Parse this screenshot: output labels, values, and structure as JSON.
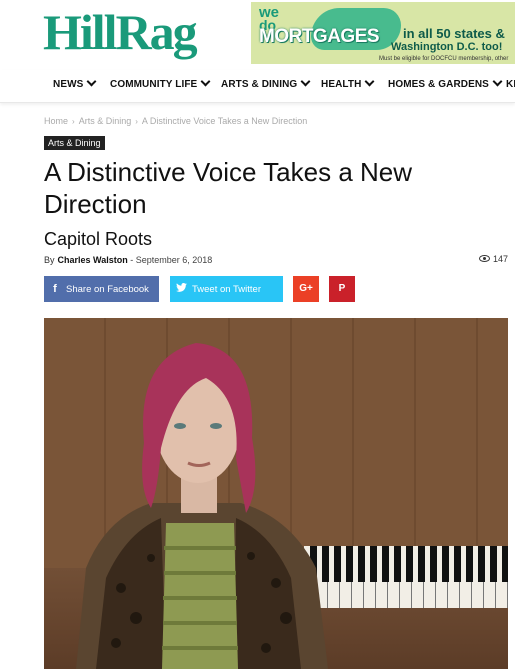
{
  "site": {
    "logo": "HillRag"
  },
  "ad": {
    "line1": "we",
    "line2": "do",
    "headline": "MORTGAGES",
    "states": "in all 50 states &",
    "dc": "Washington D.C. too!",
    "fine_print": "Must be eligible for DOCFCU membership, other"
  },
  "nav": {
    "items": [
      {
        "label": "NEWS"
      },
      {
        "label": "COMMUNITY LIFE"
      },
      {
        "label": "ARTS & DINING"
      },
      {
        "label": "HEALTH"
      },
      {
        "label": "HOMES & GARDENS"
      },
      {
        "label": "KI"
      }
    ]
  },
  "breadcrumb": {
    "items": [
      "Home",
      "Arts & Dining",
      "A Distinctive Voice Takes a New Direction"
    ],
    "separator": "›"
  },
  "article": {
    "category": "Arts & Dining",
    "title": "A Distinctive Voice Takes a New Direction",
    "subtitle": "Capitol Roots",
    "by_label": "By",
    "author": "Charles Walston",
    "date_separator": "-",
    "date": "September 6, 2018",
    "views": "147"
  },
  "share": {
    "facebook_icon": "f",
    "facebook_label": "Share on Facebook",
    "twitter_label": "Tweet on Twitter",
    "googleplus_icon": "G+",
    "pinterest_icon": "P"
  },
  "colors": {
    "brand": "#1a9a7a",
    "facebook": "#516eab",
    "twitter": "#29c5f6",
    "googleplus": "#eb4026",
    "pinterest": "#ca212a"
  }
}
